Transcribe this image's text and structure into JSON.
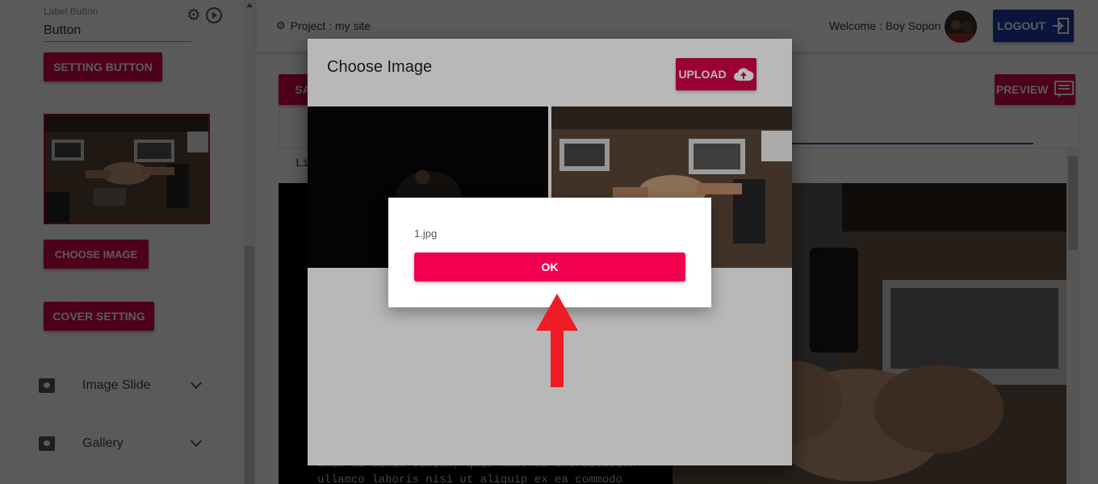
{
  "sidebar": {
    "field_label": "Label Button",
    "field_value": "Button",
    "setting_button": "SETTING BUTTON",
    "choose_image_button": "CHOOSE IMAGE",
    "cover_setting_button": "COVER SETTING",
    "accordion": [
      {
        "label": "Image Slide",
        "icon": "image-icon"
      },
      {
        "label": "Gallery",
        "icon": "image-icon"
      }
    ]
  },
  "header": {
    "project": "Project : my site",
    "welcome": "Welcome : Boy Sopon",
    "logout_label": "LOGOUT"
  },
  "main": {
    "save_label": "SA",
    "preview_label": "PREVIEW",
    "mono_snippet": "Li",
    "editor_text": "enim ad minim veniam, quis nostrud exercitation\nullamco laboris nisi ut aliquip ex ea commodo"
  },
  "dialog": {
    "title": "Choose Image",
    "upload_label": "UPLOAD"
  },
  "alert": {
    "file_name": "1.jpg",
    "ok_label": "OK"
  },
  "colors": {
    "accent": "#d6004b",
    "ok_button": "#f2004f",
    "logout": "#1a3caa",
    "arrow": "#ee1c25"
  }
}
